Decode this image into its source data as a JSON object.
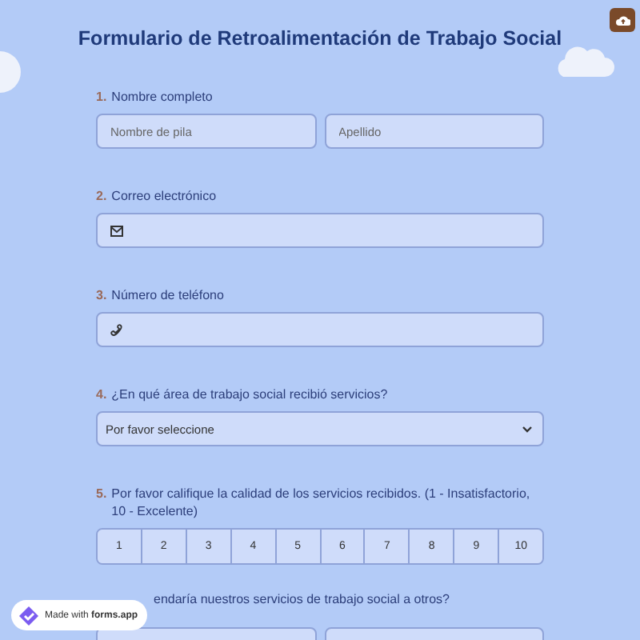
{
  "title": "Formulario de Retroalimentación de Trabajo Social",
  "questions": [
    {
      "number": "1.",
      "label": "Nombre completo",
      "kind": "name",
      "placeholders": [
        "Nombre de pila",
        "Apellido"
      ]
    },
    {
      "number": "2.",
      "label": "Correo electrónico",
      "kind": "email"
    },
    {
      "number": "3.",
      "label": "Número de teléfono",
      "kind": "phone"
    },
    {
      "number": "4.",
      "label": "¿En qué área de trabajo social recibió servicios?",
      "kind": "select",
      "value": "Por favor seleccione"
    },
    {
      "number": "5.",
      "label": "Por favor califique la calidad de los servicios recibidos. (1 - Insatisfactorio, 10 - Excelente)",
      "kind": "scale",
      "options": [
        "1",
        "2",
        "3",
        "4",
        "5",
        "6",
        "7",
        "8",
        "9",
        "10"
      ]
    },
    {
      "label": "endaría nuestros servicios de trabajo social a otros?",
      "kind": "choice"
    }
  ],
  "badge": "Made with **forms.app**"
}
